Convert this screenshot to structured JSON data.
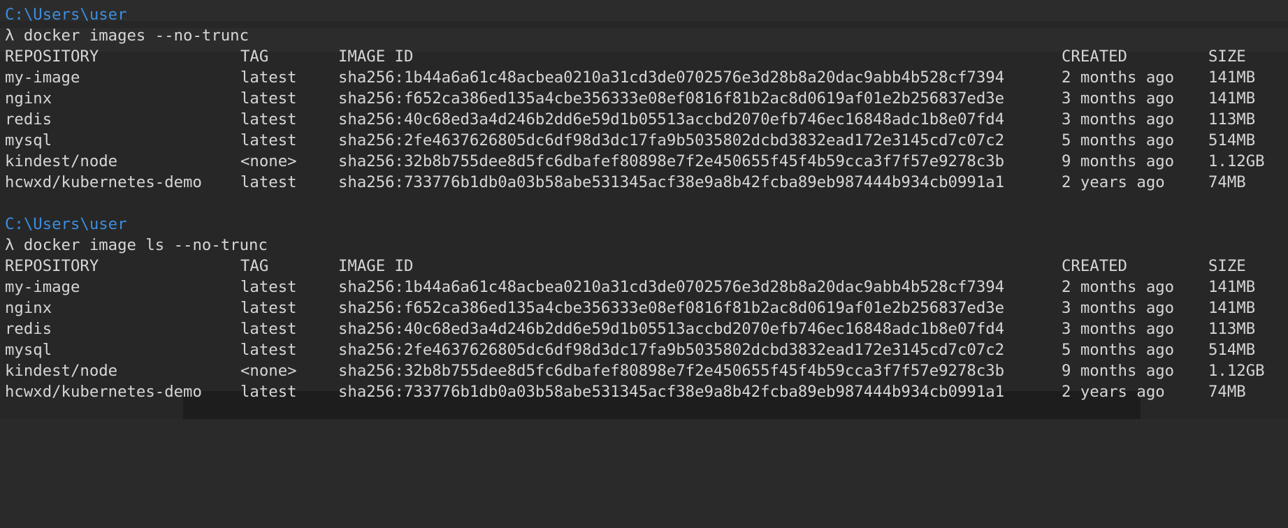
{
  "colors": {
    "background": "#272727",
    "text": "#d6d6d6",
    "path": "#3b8ee0"
  },
  "blocks": [
    {
      "path": "C:\\Users\\user",
      "command": "λ docker images --no-trunc",
      "headers": {
        "repository": "REPOSITORY",
        "tag": "TAG",
        "image_id": "IMAGE ID",
        "created": "CREATED",
        "size": "SIZE"
      },
      "rows": [
        {
          "repository": "my-image",
          "tag": "latest",
          "image_id": "sha256:1b44a6a61c48acbea0210a31cd3de0702576e3d28b8a20dac9abb4b528cf7394",
          "created": "2 months ago",
          "size": "141MB"
        },
        {
          "repository": "nginx",
          "tag": "latest",
          "image_id": "sha256:f652ca386ed135a4cbe356333e08ef0816f81b2ac8d0619af01e2b256837ed3e",
          "created": "3 months ago",
          "size": "141MB"
        },
        {
          "repository": "redis",
          "tag": "latest",
          "image_id": "sha256:40c68ed3a4d246b2dd6e59d1b05513accbd2070efb746ec16848adc1b8e07fd4",
          "created": "3 months ago",
          "size": "113MB"
        },
        {
          "repository": "mysql",
          "tag": "latest",
          "image_id": "sha256:2fe4637626805dc6df98d3dc17fa9b5035802dcbd3832ead172e3145cd7c07c2",
          "created": "5 months ago",
          "size": "514MB"
        },
        {
          "repository": "kindest/node",
          "tag": "<none>",
          "image_id": "sha256:32b8b755dee8d5fc6dbafef80898e7f2e450655f45f4b59cca3f7f57e9278c3b",
          "created": "9 months ago",
          "size": "1.12GB"
        },
        {
          "repository": "hcwxd/kubernetes-demo",
          "tag": "latest",
          "image_id": "sha256:733776b1db0a03b58abe531345acf38e9a8b42fcba89eb987444b934cb0991a1",
          "created": "2 years ago",
          "size": "74MB"
        }
      ]
    },
    {
      "path": "C:\\Users\\user",
      "command": "λ docker image ls --no-trunc",
      "headers": {
        "repository": "REPOSITORY",
        "tag": "TAG",
        "image_id": "IMAGE ID",
        "created": "CREATED",
        "size": "SIZE"
      },
      "rows": [
        {
          "repository": "my-image",
          "tag": "latest",
          "image_id": "sha256:1b44a6a61c48acbea0210a31cd3de0702576e3d28b8a20dac9abb4b528cf7394",
          "created": "2 months ago",
          "size": "141MB"
        },
        {
          "repository": "nginx",
          "tag": "latest",
          "image_id": "sha256:f652ca386ed135a4cbe356333e08ef0816f81b2ac8d0619af01e2b256837ed3e",
          "created": "3 months ago",
          "size": "141MB"
        },
        {
          "repository": "redis",
          "tag": "latest",
          "image_id": "sha256:40c68ed3a4d246b2dd6e59d1b05513accbd2070efb746ec16848adc1b8e07fd4",
          "created": "3 months ago",
          "size": "113MB"
        },
        {
          "repository": "mysql",
          "tag": "latest",
          "image_id": "sha256:2fe4637626805dc6df98d3dc17fa9b5035802dcbd3832ead172e3145cd7c07c2",
          "created": "5 months ago",
          "size": "514MB"
        },
        {
          "repository": "kindest/node",
          "tag": "<none>",
          "image_id": "sha256:32b8b755dee8d5fc6dbafef80898e7f2e450655f45f4b59cca3f7f57e9278c3b",
          "created": "9 months ago",
          "size": "1.12GB"
        },
        {
          "repository": "hcwxd/kubernetes-demo",
          "tag": "latest",
          "image_id": "sha256:733776b1db0a03b58abe531345acf38e9a8b42fcba89eb987444b934cb0991a1",
          "created": "2 years ago",
          "size": "74MB"
        }
      ]
    }
  ]
}
